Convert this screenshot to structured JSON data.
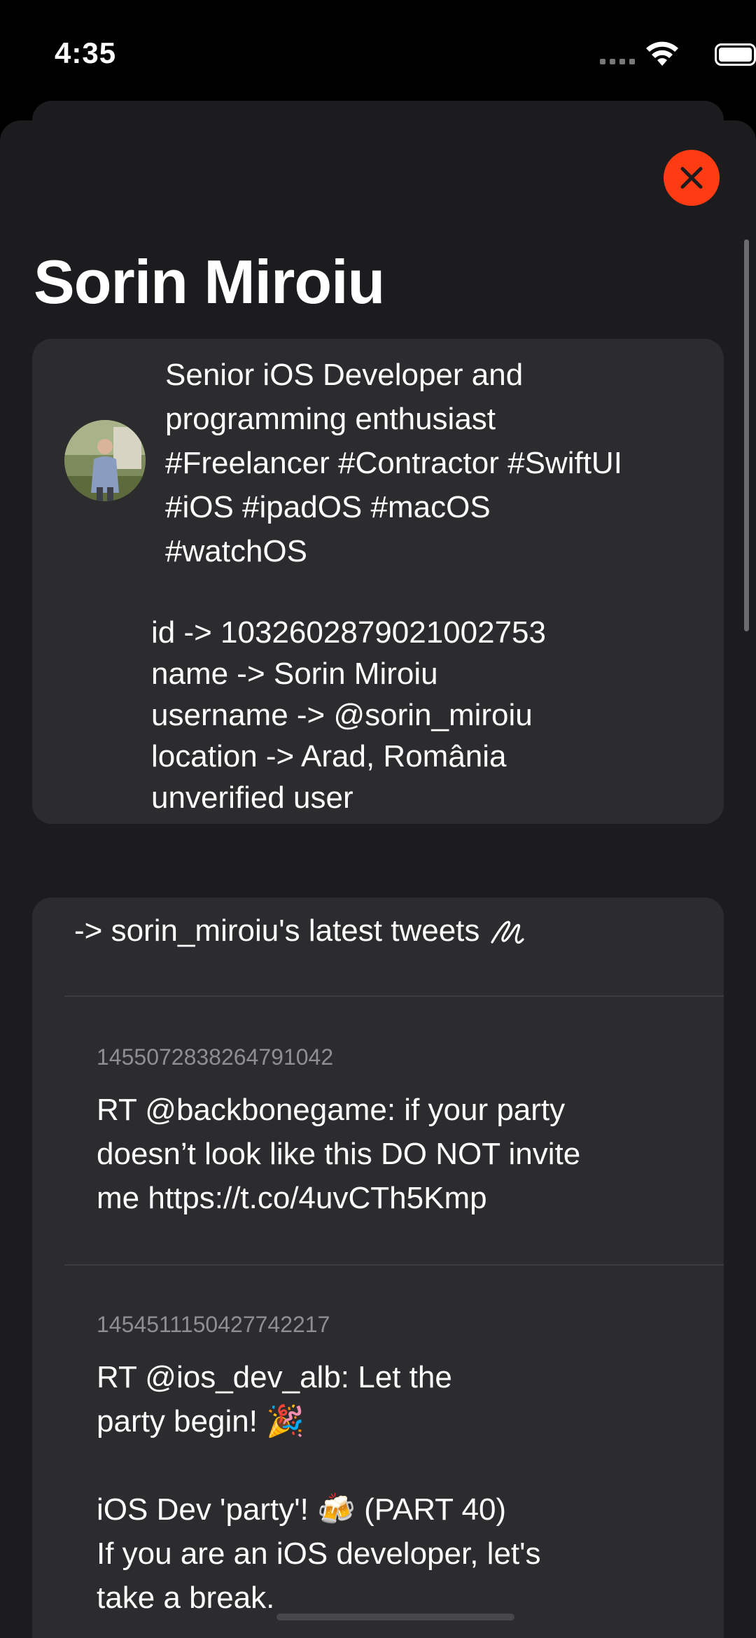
{
  "status_bar": {
    "time": "4:35"
  },
  "sheet": {
    "title": "Sorin Miroiu",
    "close_icon": "close-icon"
  },
  "profile": {
    "bio_lines": [
      "Senior iOS Developer and",
      "programming enthusiast",
      "#Freelancer #Contractor #SwiftUI",
      "#iOS #ipadOS #macOS",
      "#watchOS"
    ],
    "details": [
      "id -> 1032602879021002753",
      "name -> Sorin Miroiu",
      "username -> @sorin_miroiu",
      "location -> Arad, România",
      "unverified user"
    ]
  },
  "tweets": {
    "header": "-> sorin_miroiu's latest tweets",
    "header_icon": "scribble-icon",
    "items": [
      {
        "id": "1455072838264791042",
        "lines": [
          "RT @backbonegame: if your party",
          "doesn’t look like this DO NOT invite",
          "me https://t.co/4uvCTh5Kmp"
        ]
      },
      {
        "id": "1454511150427742217",
        "lines": [
          "RT @ios_dev_alb: Let the",
          "party begin! 🎉",
          "",
          "iOS Dev 'party'! 🍻 (PART 40)",
          "If you are an iOS developer, let's",
          "take a break."
        ]
      }
    ]
  },
  "colors": {
    "background": "#000000",
    "sheet": "#1c1c1e",
    "card": "#2c2c2e",
    "close_button": "#ff3b14",
    "secondary_text": "#8e8e93"
  }
}
